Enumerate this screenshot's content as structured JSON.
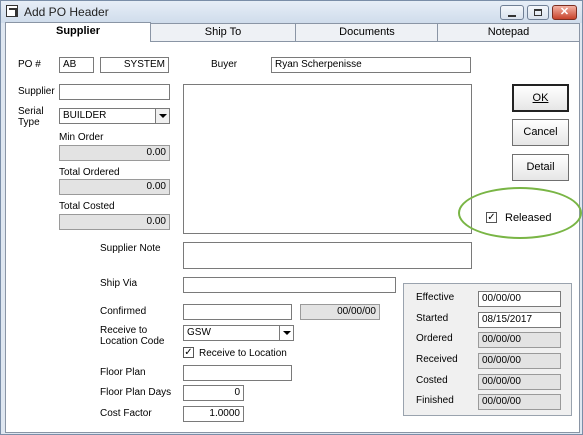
{
  "window": {
    "title": "Add PO Header",
    "buttons": {
      "minimize": "minimize-icon",
      "maximize": "maximize-icon",
      "close": "close-icon"
    }
  },
  "tabs": [
    {
      "label": "Supplier"
    },
    {
      "label": "Ship To"
    },
    {
      "label": "Documents"
    },
    {
      "label": "Notepad"
    }
  ],
  "form": {
    "po_label": "PO #",
    "po_prefix": "AB",
    "po_number": "SYSTEM",
    "buyer_label": "Buyer",
    "buyer_value": "Ryan Scherpenisse",
    "supplier_label": "Supplier",
    "supplier_value": "",
    "serial_type_label": "Serial\nType",
    "serial_type_value": "BUILDER",
    "min_order_label": "Min Order",
    "min_order_value": "0.00",
    "total_ordered_label": "Total Ordered",
    "total_ordered_value": "0.00",
    "total_costed_label": "Total Costed",
    "total_costed_value": "0.00",
    "supplier_note_label": "Supplier Note",
    "ship_via_label": "Ship Via",
    "confirmed_label": "Confirmed",
    "confirmed_date": "00/00/00",
    "receive_to_location_code_label": "Receive to\nLocation Code",
    "receive_to_location_code_value": "GSW",
    "receive_to_location_label": "Receive to Location",
    "receive_to_location_checked": true,
    "floor_plan_label": "Floor Plan",
    "floor_plan_days_label": "Floor Plan Days",
    "floor_plan_days_value": "0",
    "cost_factor_label": "Cost Factor",
    "cost_factor_value": "1.0000",
    "released_label": "Released",
    "released_checked": true
  },
  "actions": {
    "ok_label": "OK",
    "cancel_label": "Cancel",
    "detail_label": "Detail"
  },
  "dates": [
    {
      "label": "Effective",
      "value": "00/00/00"
    },
    {
      "label": "Started",
      "value": "08/15/2017"
    },
    {
      "label": "Ordered",
      "value": "00/00/00"
    },
    {
      "label": "Received",
      "value": "00/00/00"
    },
    {
      "label": "Costed",
      "value": "00/00/00"
    },
    {
      "label": "Finished",
      "value": "00/00/00"
    }
  ],
  "colors": {
    "highlight_ring": "#79b545"
  }
}
